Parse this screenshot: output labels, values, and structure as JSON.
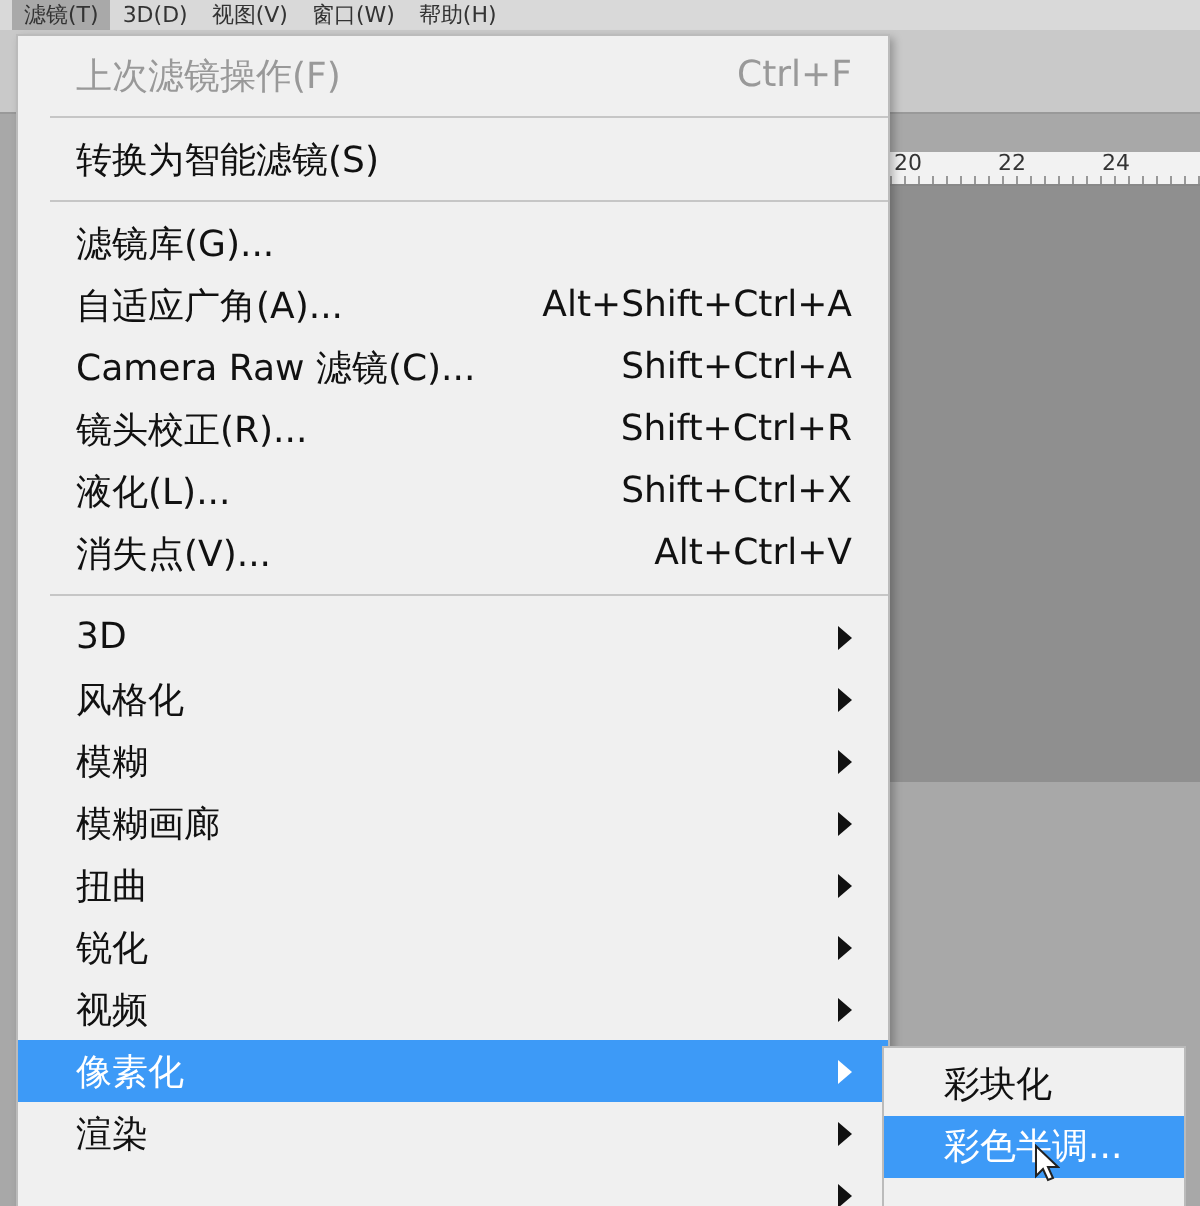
{
  "menubar": [
    {
      "label": "滤镜(T)",
      "selected": true
    },
    {
      "label": "3D(D)",
      "selected": false
    },
    {
      "label": "视图(V)",
      "selected": false
    },
    {
      "label": "窗口(W)",
      "selected": false
    },
    {
      "label": "帮助(H)",
      "selected": false
    }
  ],
  "ruler": [
    "20",
    "22",
    "24"
  ],
  "menu": {
    "groups": [
      [
        {
          "label": "上次滤镜操作(F)",
          "shortcut": "Ctrl+F",
          "disabled": true,
          "submenu": false,
          "selected": false
        }
      ],
      [
        {
          "label": "转换为智能滤镜(S)",
          "disabled": false,
          "submenu": false,
          "selected": false
        }
      ],
      [
        {
          "label": "滤镜库(G)...",
          "disabled": false,
          "submenu": false,
          "selected": false
        },
        {
          "label": "自适应广角(A)...",
          "shortcut": "Alt+Shift+Ctrl+A",
          "disabled": false,
          "submenu": false,
          "selected": false
        },
        {
          "label": "Camera Raw 滤镜(C)...",
          "shortcut": "Shift+Ctrl+A",
          "disabled": false,
          "submenu": false,
          "selected": false
        },
        {
          "label": "镜头校正(R)...",
          "shortcut": "Shift+Ctrl+R",
          "disabled": false,
          "submenu": false,
          "selected": false
        },
        {
          "label": "液化(L)...",
          "shortcut": "Shift+Ctrl+X",
          "disabled": false,
          "submenu": false,
          "selected": false
        },
        {
          "label": "消失点(V)...",
          "shortcut": "Alt+Ctrl+V",
          "disabled": false,
          "submenu": false,
          "selected": false
        }
      ],
      [
        {
          "label": "3D",
          "disabled": false,
          "submenu": true,
          "selected": false
        },
        {
          "label": "风格化",
          "disabled": false,
          "submenu": true,
          "selected": false
        },
        {
          "label": "模糊",
          "disabled": false,
          "submenu": true,
          "selected": false
        },
        {
          "label": "模糊画廊",
          "disabled": false,
          "submenu": true,
          "selected": false
        },
        {
          "label": "扭曲",
          "disabled": false,
          "submenu": true,
          "selected": false
        },
        {
          "label": "锐化",
          "disabled": false,
          "submenu": true,
          "selected": false
        },
        {
          "label": "视频",
          "disabled": false,
          "submenu": true,
          "selected": false
        },
        {
          "label": "像素化",
          "disabled": false,
          "submenu": true,
          "selected": true
        },
        {
          "label": "渲染",
          "disabled": false,
          "submenu": true,
          "selected": false
        },
        {
          "disabled": false,
          "submenu": true,
          "selected": false
        }
      ]
    ]
  },
  "submenu": [
    {
      "label": "彩块化",
      "selected": false
    },
    {
      "label": "彩色半调...",
      "selected": true
    }
  ]
}
